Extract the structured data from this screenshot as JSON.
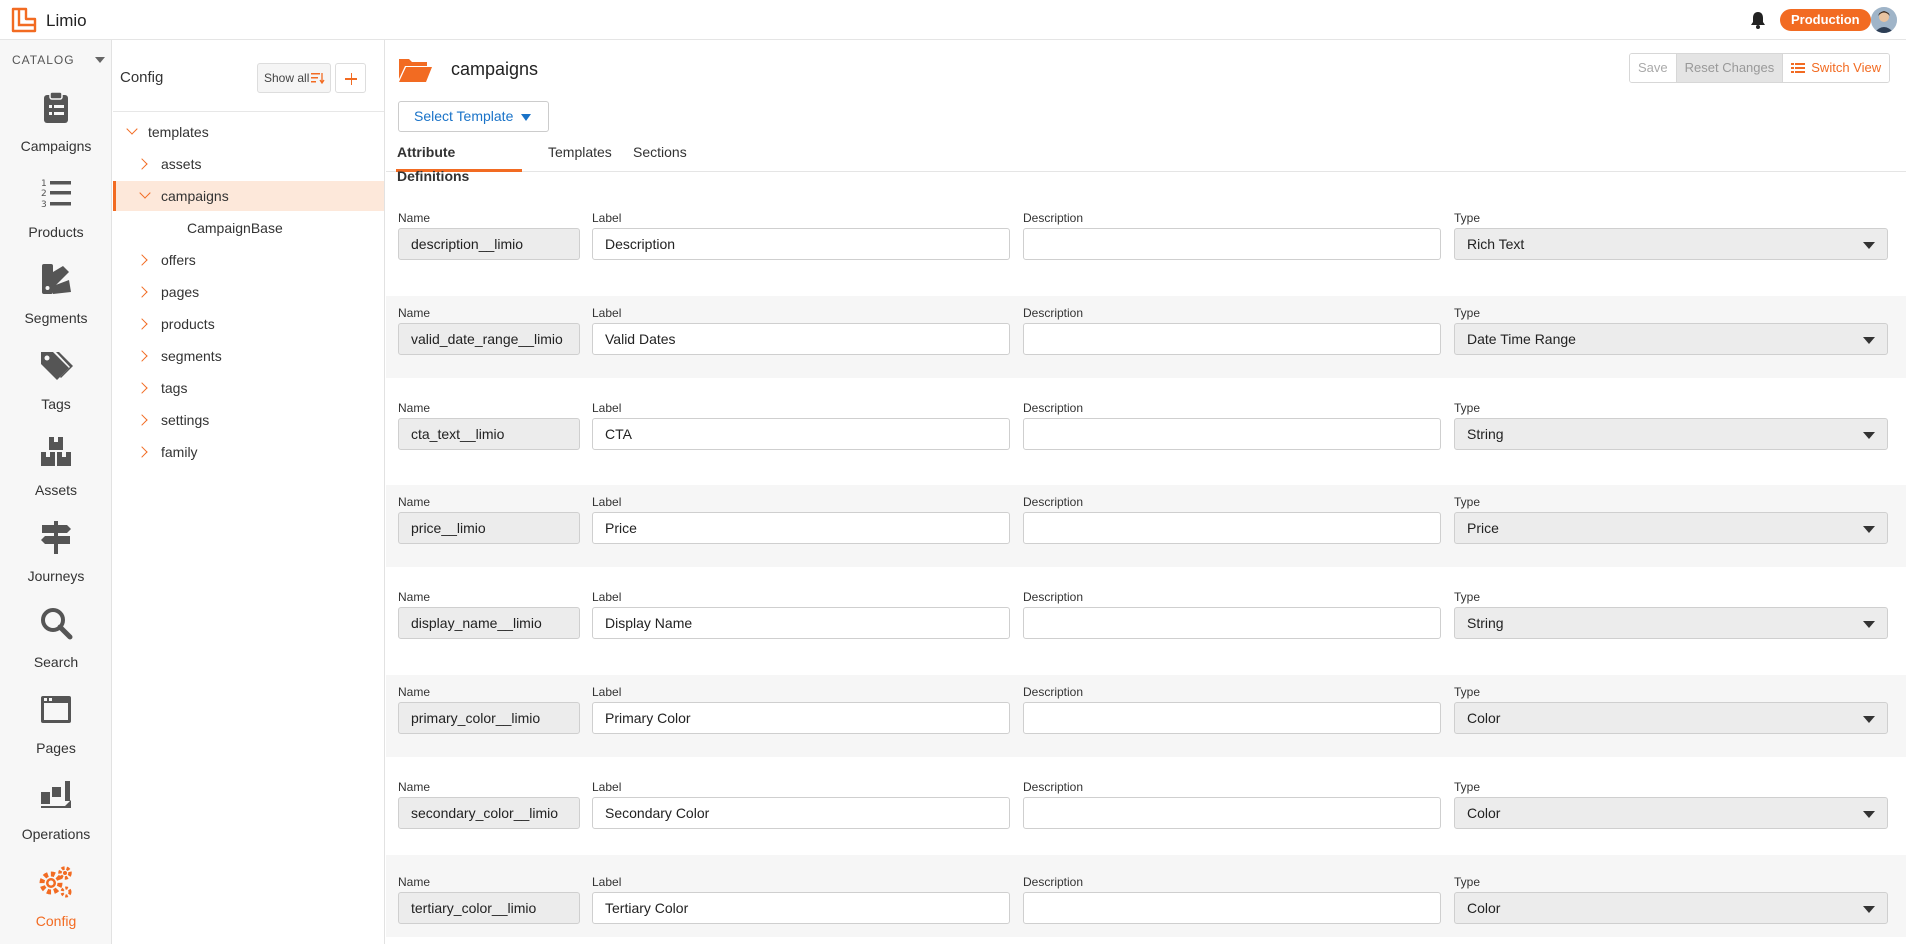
{
  "app": {
    "name": "Limio",
    "environment": "Production"
  },
  "nav": {
    "section": "CATALOG",
    "items": [
      {
        "label": "Campaigns",
        "icon": "clipboard-icon"
      },
      {
        "label": "Products",
        "icon": "numbered-list-icon"
      },
      {
        "label": "Segments",
        "icon": "segments-icon"
      },
      {
        "label": "Tags",
        "icon": "tags-icon"
      },
      {
        "label": "Assets",
        "icon": "boxes-icon"
      },
      {
        "label": "Journeys",
        "icon": "signpost-icon"
      },
      {
        "label": "Search",
        "icon": "search-icon"
      },
      {
        "label": "Pages",
        "icon": "browser-window-icon"
      },
      {
        "label": "Operations",
        "icon": "operations-icon"
      },
      {
        "label": "Config",
        "icon": "gears-icon",
        "active": true
      }
    ]
  },
  "tree": {
    "title": "Config",
    "show_all": "Show all",
    "rows": [
      {
        "label": "templates",
        "state": "expanded",
        "level": 0
      },
      {
        "label": "assets",
        "state": "collapsed",
        "level": 1
      },
      {
        "label": "campaigns",
        "state": "expanded",
        "level": 1,
        "selected": true
      },
      {
        "label": "CampaignBase",
        "state": "leaf",
        "level": 2
      },
      {
        "label": "offers",
        "state": "collapsed",
        "level": 1
      },
      {
        "label": "pages",
        "state": "collapsed",
        "level": 1
      },
      {
        "label": "products",
        "state": "collapsed",
        "level": 1
      },
      {
        "label": "segments",
        "state": "collapsed",
        "level": 1
      },
      {
        "label": "tags",
        "state": "collapsed",
        "level": 1
      },
      {
        "label": "settings",
        "state": "collapsed",
        "level": 1
      },
      {
        "label": "family",
        "state": "collapsed",
        "level": 1
      }
    ]
  },
  "main": {
    "title": "campaigns",
    "buttons": {
      "save": "Save",
      "reset": "Reset Changes",
      "switch_view": "Switch View"
    },
    "select_template": "Select Template",
    "tabs": [
      "Attribute Definitions",
      "Templates",
      "Sections"
    ],
    "field_labels": {
      "name": "Name",
      "label": "Label",
      "description": "Description",
      "type": "Type"
    },
    "attributes": [
      {
        "name": "description__limio",
        "label": "Description",
        "description": "",
        "type": "Rich Text"
      },
      {
        "name": "valid_date_range__limio",
        "label": "Valid Dates",
        "description": "",
        "type": "Date Time Range"
      },
      {
        "name": "cta_text__limio",
        "label": "CTA",
        "description": "",
        "type": "String"
      },
      {
        "name": "price__limio",
        "label": "Price",
        "description": "",
        "type": "Price"
      },
      {
        "name": "display_name__limio",
        "label": "Display Name",
        "description": "",
        "type": "String"
      },
      {
        "name": "primary_color__limio",
        "label": "Primary Color",
        "description": "",
        "type": "Color"
      },
      {
        "name": "secondary_color__limio",
        "label": "Secondary Color",
        "description": "",
        "type": "Color"
      },
      {
        "name": "tertiary_color__limio",
        "label": "Tertiary Color",
        "description": "",
        "type": "Color"
      }
    ]
  },
  "colors": {
    "accent": "#f26b22",
    "link": "#1a73c8"
  }
}
